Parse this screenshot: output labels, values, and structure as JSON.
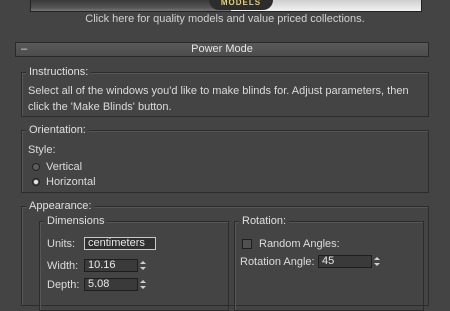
{
  "banner": {
    "logo_text": "MODELS",
    "caption": "Click here for quality models and value priced collections."
  },
  "rollout": {
    "collapse_symbol": "–",
    "title": "Power Mode"
  },
  "instructions": {
    "legend": "Instructions:",
    "line1": "Select all of the windows you'd like to make blinds for.  Adjust parameters, then",
    "line2": "click the 'Make Blinds' button."
  },
  "orientation": {
    "legend": "Orientation:",
    "style_label": "Style:",
    "options": [
      {
        "label": "Vertical",
        "selected": false
      },
      {
        "label": "Horizontal",
        "selected": true
      }
    ]
  },
  "appearance": {
    "legend": "Appearance:",
    "dimensions": {
      "legend": "Dimensions",
      "units_label": "Units:",
      "units_value": "centimeters",
      "width_label": "Width:",
      "width_value": "10.16",
      "depth_label": "Depth:",
      "depth_value": "5.08"
    },
    "rotation": {
      "legend": "Rotation:",
      "random_label": "Random Angles:",
      "random_checked": false,
      "angle_label": "Rotation Angle:",
      "angle_value": "45"
    }
  }
}
